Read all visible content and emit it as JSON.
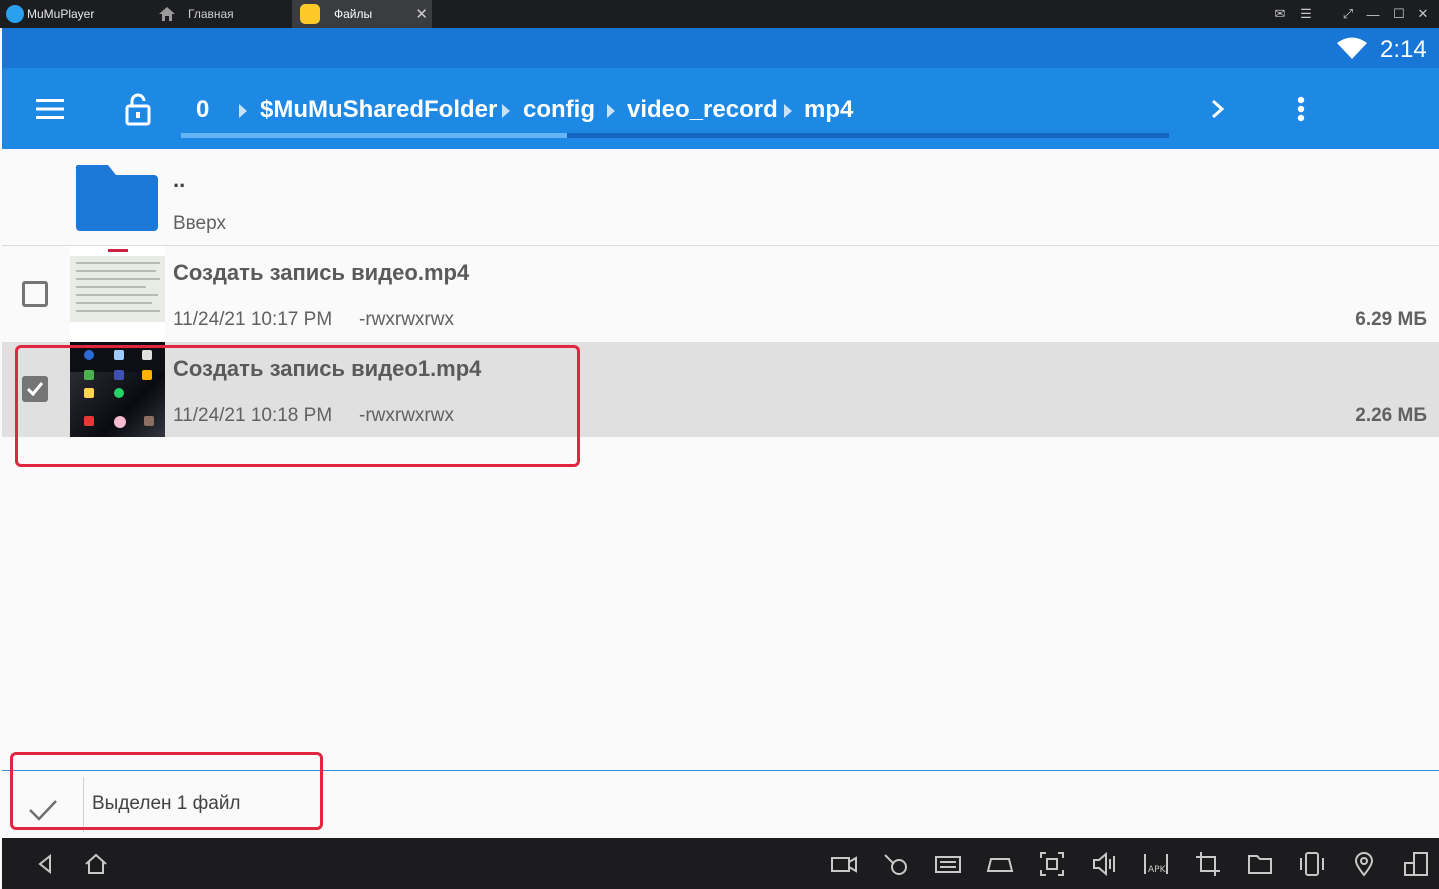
{
  "host": {
    "app_name": "MuMuPlayer",
    "tabs": [
      {
        "label": "Главная"
      },
      {
        "label": "Файлы"
      }
    ]
  },
  "status": {
    "time": "2:14"
  },
  "toolbar": {
    "breadcrumbs": [
      "0",
      "$MuMuSharedFolder",
      "config",
      "video_record",
      "mp4"
    ]
  },
  "files": {
    "parent": {
      "name": "..",
      "label": "Вверх"
    },
    "items": [
      {
        "name": "Создать запись видео.mp4",
        "date": "11/24/21 10:17 PM",
        "perms": "-rwxrwxrwx",
        "size": "6.29 МБ",
        "checked": false
      },
      {
        "name": "Создать запись видео1.mp4",
        "date": "11/24/21 10:18 PM",
        "perms": "-rwxrwxrwx",
        "size": "2.26 МБ",
        "checked": true
      }
    ]
  },
  "selection": {
    "text": "Выделен 1 файл"
  },
  "colors": {
    "toolbar": "#1e88e5",
    "statusbar": "#1877d6",
    "highlight": "#e0273f",
    "selected_row": "#e0e0e0"
  }
}
